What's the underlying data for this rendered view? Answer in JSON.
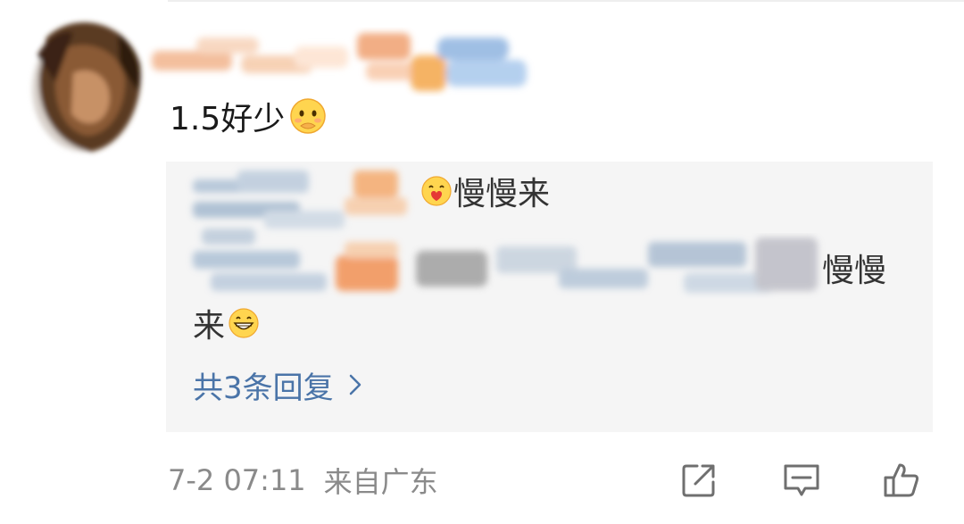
{
  "comment": {
    "text": "1.5好少",
    "emoji": "pleading-face-emoji"
  },
  "reply_box": {
    "reply_1_suffix": "慢慢来",
    "reply_1_emoji": "hugging-heart-emoji",
    "reply_2_suffix": "慢慢",
    "reply_2_line2": "来",
    "reply_2_emoji": "grinning-face-emoji",
    "reply_count_label": "共3条回复"
  },
  "meta": {
    "timestamp": "7-2 07:11",
    "source": "来自广东"
  },
  "actions": {
    "share_icon": "share-icon",
    "comment_icon": "comment-icon",
    "like_icon": "thumbs-up-icon"
  },
  "colors": {
    "link": "#4a74a8",
    "reply_bg": "#f5f5f5",
    "meta_text": "#8a8a8a"
  }
}
